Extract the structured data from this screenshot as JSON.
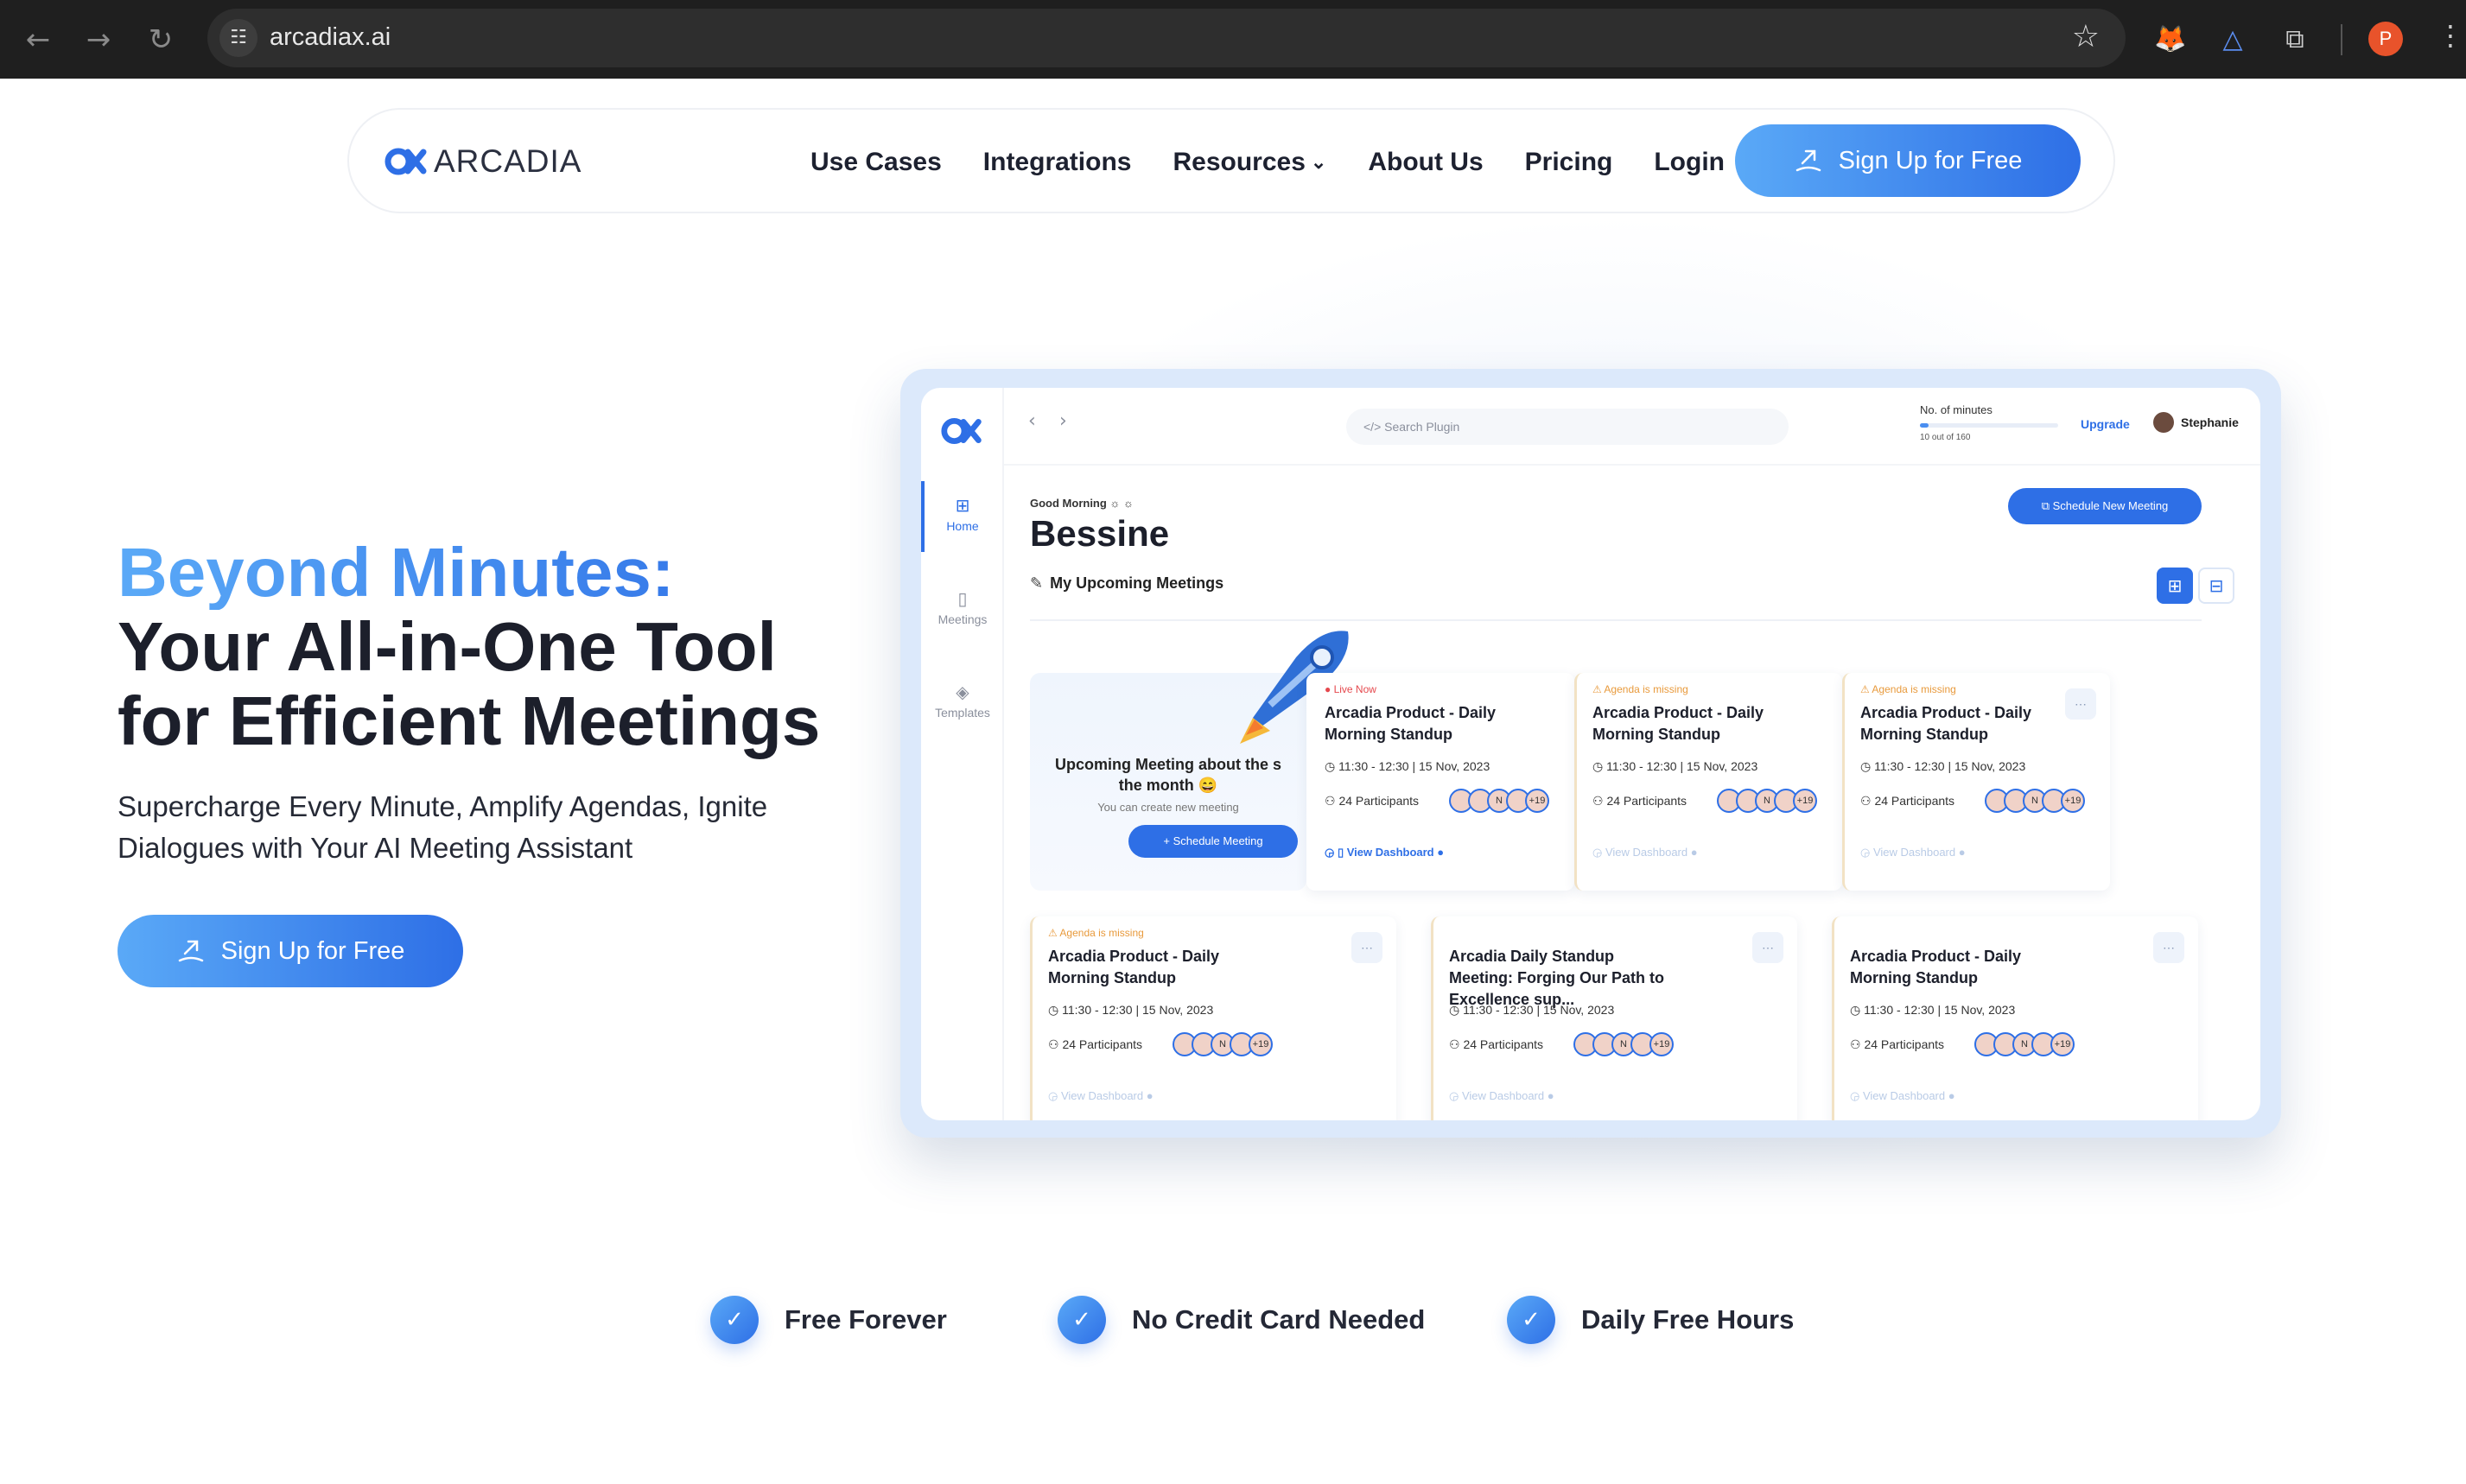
{
  "browser": {
    "back_icon": "←",
    "forward_icon": "→",
    "reload_icon": "↻",
    "site_icon": "☷",
    "url": "arcadiax.ai",
    "star_icon": "☆",
    "profile_initial": "P",
    "menu_icon": "⋮"
  },
  "nav": {
    "logo_text": "ARCADIA",
    "links": [
      "Use Cases",
      "Integrations",
      "Resources",
      "About Us",
      "Pricing",
      "Login"
    ],
    "resources_chevron": "⌄",
    "cta": "Sign Up for Free"
  },
  "hero": {
    "title_accent": "Beyond Minutes:",
    "title_line2": "Your All-in-One Tool",
    "title_line3": "for Efficient Meetings",
    "subtitle": "Supercharge Every Minute, Amplify Agendas, Ignite Dialogues with Your AI Meeting Assistant",
    "cta": "Sign Up for Free"
  },
  "mock": {
    "sidebar": [
      {
        "label": "Home",
        "icon": "⊞"
      },
      {
        "label": "Meetings",
        "icon": "▯"
      },
      {
        "label": "Templates",
        "icon": "◈"
      }
    ],
    "search_placeholder": "</> Search Plugin",
    "minutes_label": "No. of minutes",
    "minutes_used": "10 out of 160",
    "minutes_progress": 0.0625,
    "upgrade": "Upgrade",
    "user": "Stephanie",
    "greeting": "Good Morning ☼ ☼",
    "name": "Bessine",
    "schedule_button": "⧉ Schedule New Meeting",
    "upcoming_heading": "My Upcoming Meetings",
    "promo": {
      "title": "Upcoming Meeting about the s\nthe month 😄",
      "subtitle": "You can create new meeting",
      "button": "+ Schedule Meeting"
    },
    "cards": [
      {
        "badge": "● Live Now",
        "title": "Arcadia Product - Daily Morning Standup",
        "time": "◷ 11:30 - 12:30 | 15 Nov, 2023",
        "participants": "⚇ 24 Participants",
        "dashboard": "◶ ▯ View Dashboard ●",
        "live": true
      },
      {
        "badge": "⚠ Agenda is missing",
        "title": "Arcadia Product - Daily Morning Standup",
        "time": "◷ 11:30 - 12:30 | 15 Nov, 2023",
        "participants": "⚇ 24 Participants",
        "dashboard": "◶ View Dashboard ●",
        "live": false
      },
      {
        "badge": "⚠ Agenda is missing",
        "title": "Arcadia Product - Daily Morning Standup",
        "time": "◷ 11:30 - 12:30 | 15 Nov, 2023",
        "participants": "⚇ 24 Participants",
        "dashboard": "◶ View Dashboard ●",
        "live": false
      },
      {
        "badge": "⚠ Agenda is missing",
        "title": "Arcadia Product - Daily Morning Standup",
        "time": "◷ 11:30 - 12:30 | 15 Nov, 2023",
        "participants": "⚇ 24 Participants",
        "dashboard": "◶ View Dashboard ●",
        "live": false
      },
      {
        "badge": "",
        "title": "Arcadia Daily Standup Meeting: Forging Our Path to Excellence sup...",
        "time": "◷ 11:30 - 12:30 | 15 Nov, 2023",
        "participants": "⚇ 24 Participants",
        "dashboard": "◶ View Dashboard ●",
        "live": false
      },
      {
        "badge": "",
        "title": "Arcadia Product - Daily Morning Standup",
        "time": "◷ 11:30 - 12:30 | 15 Nov, 2023",
        "participants": "⚇ 24 Participants",
        "dashboard": "◶ View Dashboard ●",
        "live": false
      }
    ],
    "avatar_labels": [
      "",
      "",
      "N",
      "",
      "+19"
    ]
  },
  "features": [
    "Free Forever",
    "No Credit Card Needed",
    "Daily Free Hours"
  ],
  "check_icon": "✓",
  "colors": {
    "accent": "#2e6fe6",
    "accent_light": "#5aa9f7"
  }
}
